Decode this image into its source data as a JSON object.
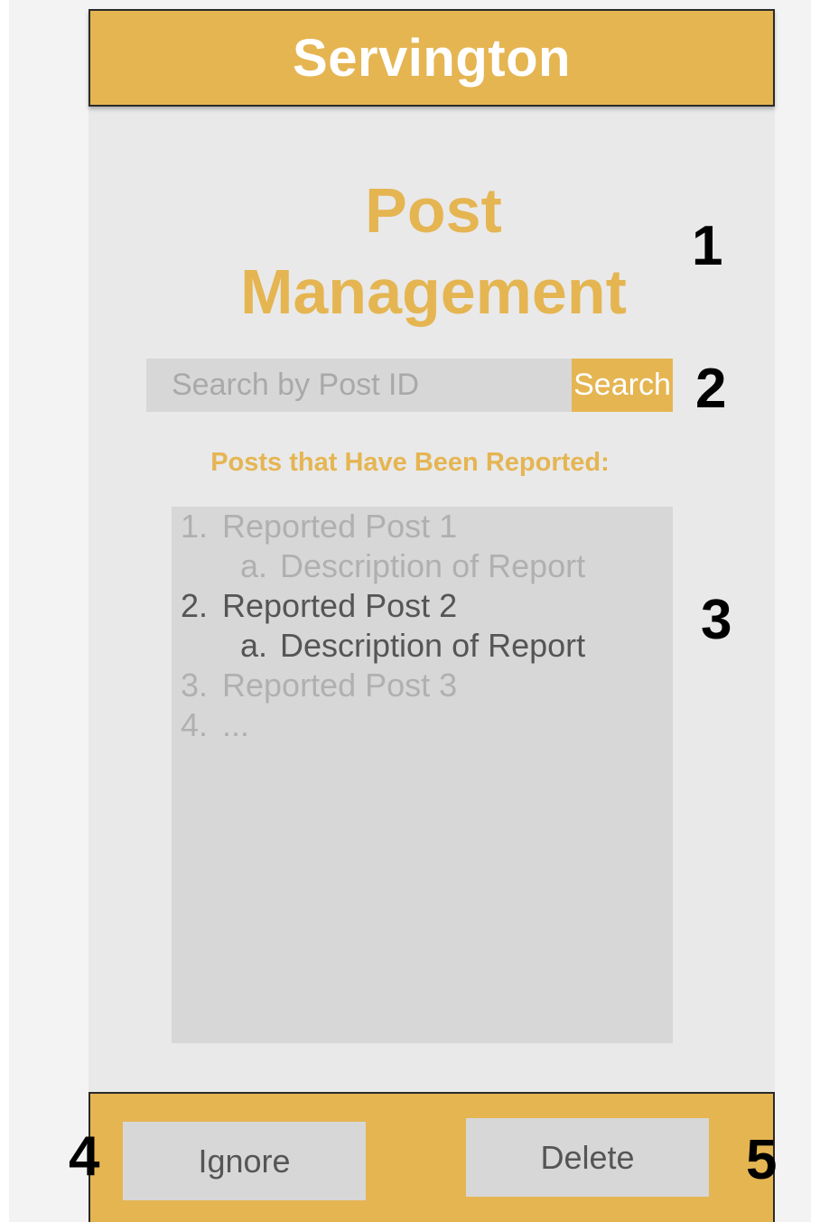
{
  "app": {
    "title": "Servington"
  },
  "page": {
    "title_line1": "Post",
    "title_line2": "Management"
  },
  "search": {
    "placeholder": "Search by Post ID",
    "button_label": "Search"
  },
  "reports": {
    "section_label": "Posts that Have Been Reported:",
    "items": [
      {
        "num": "1.",
        "label": "Reported Post 1",
        "sub_num": "a.",
        "sub_label": "Description of Report",
        "active": false
      },
      {
        "num": "2.",
        "label": "Reported Post 2",
        "sub_num": "a.",
        "sub_label": "Description of Report",
        "active": true
      },
      {
        "num": "3.",
        "label": "Reported Post 3",
        "active": false
      },
      {
        "num": "4.",
        "label": "...",
        "active": false
      }
    ]
  },
  "actions": {
    "ignore_label": "Ignore",
    "delete_label": "Delete"
  },
  "callouts": [
    "1",
    "2",
    "3",
    "4",
    "5"
  ],
  "colors": {
    "accent": "#e5b552",
    "panel": "#d7d7d7",
    "background": "#e9e9e9",
    "muted_text": "#b0b0b0",
    "active_text": "#555555"
  }
}
